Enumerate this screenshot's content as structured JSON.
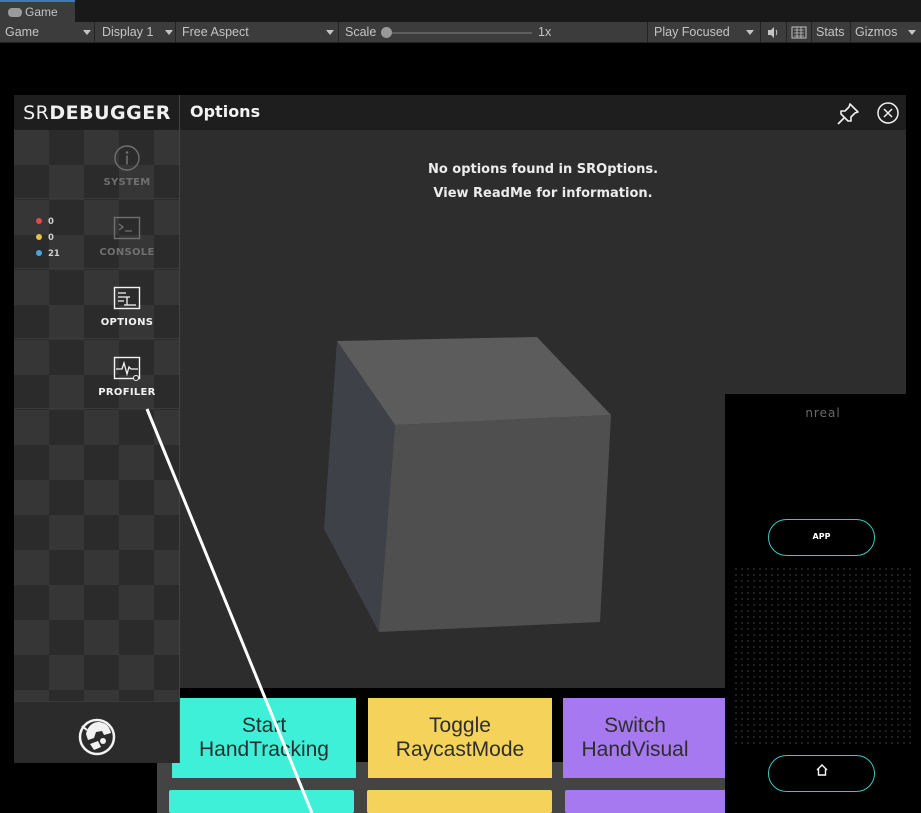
{
  "editor": {
    "tab_label": "Game",
    "toolbar": {
      "view": "Game",
      "display": "Display 1",
      "aspect": "Free Aspect",
      "scale_label": "Scale",
      "scale_value": "1x",
      "play_mode": "Play Focused",
      "stats": "Stats",
      "gizmos": "Gizmos"
    }
  },
  "srdebugger": {
    "logo_a": "SR",
    "logo_b": "DEBUGGER",
    "nav": [
      {
        "label": "SYSTEM",
        "active": false
      },
      {
        "label": "CONSOLE",
        "active": false
      },
      {
        "label": "OPTIONS",
        "active": true
      },
      {
        "label": "PROFILER",
        "active": true
      }
    ],
    "console_counts": {
      "errors": "0",
      "warnings": "0",
      "info": "21"
    },
    "header_title": "Options",
    "message_line1": "No options found in SROptions.",
    "message_line2": "View ReadMe for information."
  },
  "scene_buttons": [
    {
      "line1": "Start",
      "line2": "HandTracking",
      "color": "#3ef0d8"
    },
    {
      "line1": "Toggle",
      "line2": "RaycastMode",
      "color": "#f5d35a"
    },
    {
      "line1": "Switch",
      "line2": "HandVisual",
      "color": "#a779f0"
    }
  ],
  "controller": {
    "brand": "nreal",
    "app_button": "APP",
    "home_icon": "home-icon"
  },
  "colors": {
    "error": "#e24a4a",
    "warning": "#e8c048",
    "info": "#4aa3e0",
    "accent_teal": "#3fc7c0"
  }
}
